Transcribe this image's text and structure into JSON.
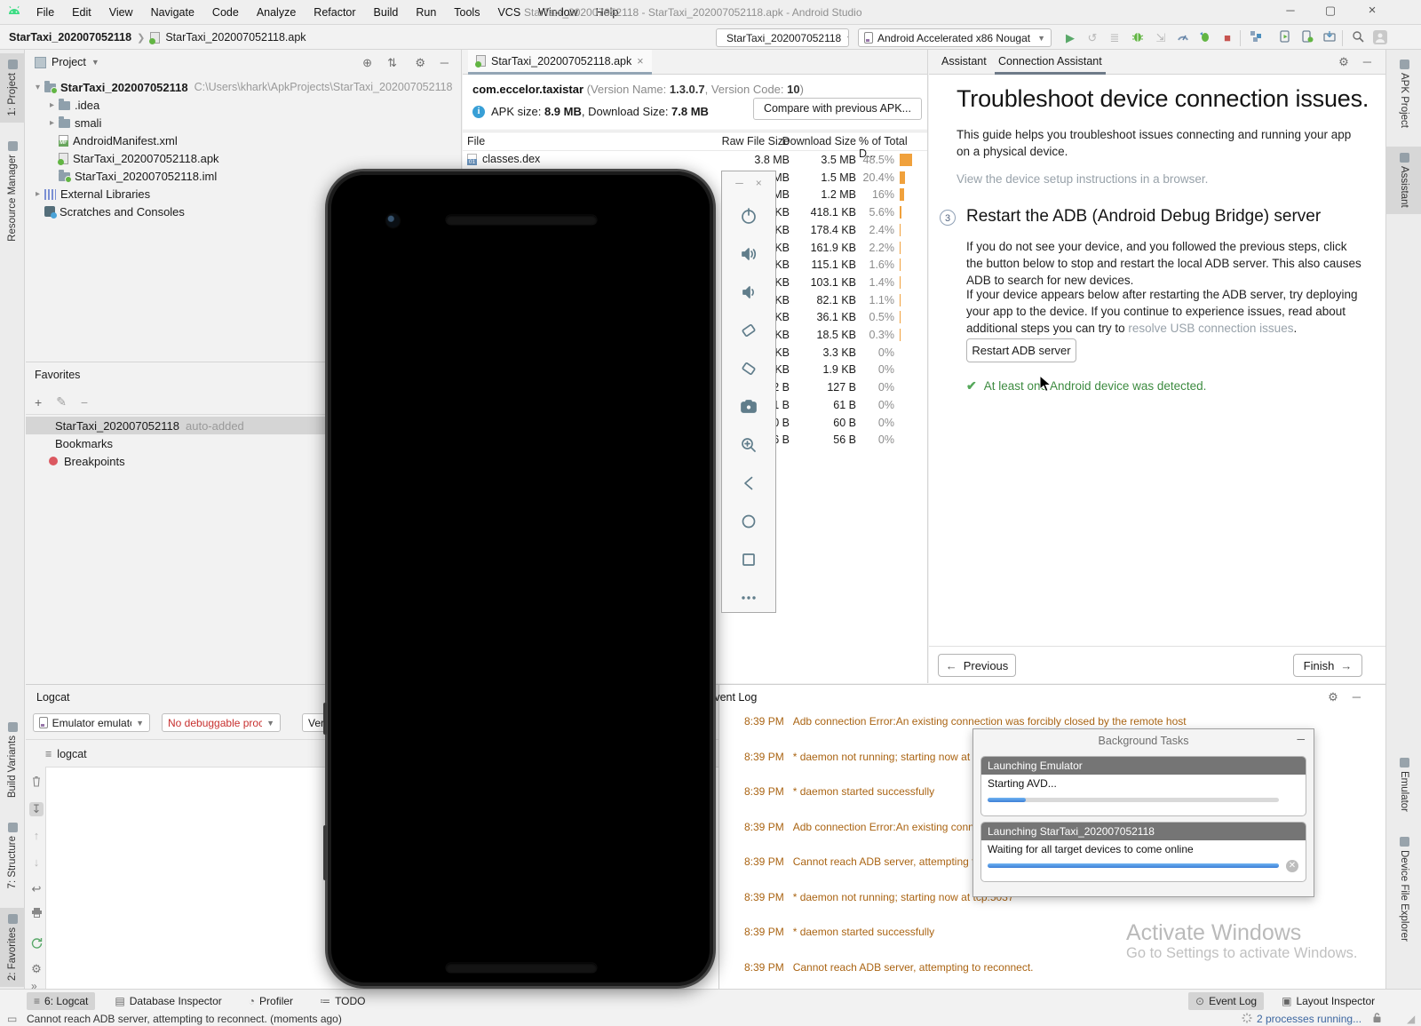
{
  "window": {
    "title": "StarTaxi_202007052118 - StarTaxi_202007052118.apk - Android Studio",
    "controls": {
      "minimize": "─",
      "maximize": "▢",
      "close": "×"
    }
  },
  "menu_items": [
    "File",
    "Edit",
    "View",
    "Navigate",
    "Code",
    "Analyze",
    "Refactor",
    "Build",
    "Run",
    "Tools",
    "VCS",
    "Window",
    "Help"
  ],
  "toolbar": {
    "breadcrumb_project": "StarTaxi_202007052118",
    "breadcrumb_file": "StarTaxi_202007052118.apk",
    "run_config": "StarTaxi_202007052118",
    "device_select": "Android Accelerated x86 Nougat"
  },
  "left_strip_top": [
    {
      "label": "1: Project",
      "sel": true
    },
    {
      "label": "Resource Manager"
    }
  ],
  "left_strip_bottom": [
    {
      "label": "Build Variants"
    },
    {
      "label": "7: Structure"
    },
    {
      "label": "2: Favorites",
      "sel": true
    }
  ],
  "right_strip_top": [
    {
      "label": "APK Project"
    },
    {
      "label": "Assistant",
      "sel": true
    }
  ],
  "right_strip_bottom": [
    {
      "label": "Emulator"
    },
    {
      "label": "Device File Explorer"
    }
  ],
  "project_panel": {
    "title": "Project",
    "tree": [
      {
        "label": "StarTaxi_202007052118",
        "path": "C:\\Users\\khark\\ApkProjects\\StarTaxi_202007052118",
        "level": 0,
        "icon": "folder-root",
        "chevron": "▾",
        "bold": true
      },
      {
        "label": ".idea",
        "level": 1,
        "icon": "folder",
        "chevron": "▸"
      },
      {
        "label": "smali",
        "level": 1,
        "icon": "folder",
        "chevron": "▸"
      },
      {
        "label": "AndroidManifest.xml",
        "level": 1,
        "icon": "manifest",
        "chevron": ""
      },
      {
        "label": "StarTaxi_202007052118.apk",
        "level": 1,
        "icon": "apk",
        "chevron": ""
      },
      {
        "label": "StarTaxi_202007052118.iml",
        "level": 1,
        "icon": "iml",
        "chevron": ""
      },
      {
        "label": "External Libraries",
        "level": 0,
        "icon": "extlib",
        "chevron": "▸"
      },
      {
        "label": "Scratches and Consoles",
        "level": 0,
        "icon": "scratch",
        "chevron": ""
      }
    ]
  },
  "favorites_panel": {
    "title": "Favorites",
    "toolbar": {
      "add": "+",
      "edit": "✎",
      "remove": "−"
    },
    "items": [
      {
        "label": "StarTaxi_202007052118",
        "suffix": "auto-added",
        "icon": "star",
        "sel": true
      },
      {
        "label": "Bookmarks",
        "suffix": "",
        "icon": "check"
      },
      {
        "label": "Breakpoints",
        "suffix": "",
        "icon": "dot"
      }
    ]
  },
  "apk_editor": {
    "tab": "StarTaxi_202007052118.apk",
    "close": "×",
    "package": "com.eccelor.taxistar",
    "v_open": " (Version Name: ",
    "version_name": "1.3.0.7",
    "v_mid": ", Version Code: ",
    "version_code": "10",
    "v_close": ")",
    "s_pre": "APK size: ",
    "apk_size": "8.9 MB",
    "s_mid": ", Download Size: ",
    "download_size": "7.8 MB",
    "compare_button": "Compare with previous APK...",
    "col_file": "File",
    "col_raw": "Raw File Size",
    "col_download": "Download Size",
    "col_pct": "% of Total D...",
    "rows": [
      {
        "file": "classes.dex",
        "raw": "3.8 MB",
        "download": "3.5 MB",
        "pct": "48.5%",
        "pct_val": 48.5
      },
      {
        "file": "",
        "raw": "MB",
        "download": "1.5 MB",
        "pct": "20.4%",
        "pct_val": 20.4
      },
      {
        "file": "",
        "raw": "MB",
        "download": "1.2 MB",
        "pct": "16%",
        "pct_val": 16
      },
      {
        "file": "",
        "raw": "KB",
        "download": "418.1 KB",
        "pct": "5.6%",
        "pct_val": 5.6
      },
      {
        "file": "",
        "raw": "KB",
        "download": "178.4 KB",
        "pct": "2.4%",
        "pct_val": 2.4
      },
      {
        "file": "",
        "raw": "KB",
        "download": "161.9 KB",
        "pct": "2.2%",
        "pct_val": 2.2
      },
      {
        "file": "",
        "raw": "KB",
        "download": "115.1 KB",
        "pct": "1.6%",
        "pct_val": 1.6
      },
      {
        "file": "",
        "raw": "KB",
        "download": "103.1 KB",
        "pct": "1.4%",
        "pct_val": 1.4
      },
      {
        "file": "",
        "raw": "KB",
        "download": "82.1 KB",
        "pct": "1.1%",
        "pct_val": 1.1
      },
      {
        "file": "",
        "raw": "KB",
        "download": "36.1 KB",
        "pct": "0.5%",
        "pct_val": 0.5
      },
      {
        "file": "",
        "raw": "KB",
        "download": "18.5 KB",
        "pct": "0.3%",
        "pct_val": 0.3
      },
      {
        "file": "",
        "raw": "KB",
        "download": "3.3 KB",
        "pct": "0%",
        "pct_val": 0
      },
      {
        "file": "",
        "raw": "KB",
        "download": "1.9 KB",
        "pct": "0%",
        "pct_val": 0
      },
      {
        "file": "",
        "raw": "2 B",
        "download": "127 B",
        "pct": "0%",
        "pct_val": 0
      },
      {
        "file": "",
        "raw": "1 B",
        "download": "61 B",
        "pct": "0%",
        "pct_val": 0
      },
      {
        "file": "",
        "raw": "0 B",
        "download": "60 B",
        "pct": "0%",
        "pct_val": 0
      },
      {
        "file": "",
        "raw": "6 B",
        "download": "56 B",
        "pct": "0%",
        "pct_val": 0
      }
    ]
  },
  "assistant_panel": {
    "tab_assistant": "Assistant",
    "tab_connection": "Connection Assistant",
    "title": "Troubleshoot device connection issues.",
    "intro": "This guide helps you troubleshoot issues connecting and running your app on a physical device.",
    "browser_link": "View the device setup instructions in a browser.",
    "step_number": "3",
    "step_title": "Restart the ADB (Android Debug Bridge) server",
    "para1": "If you do not see your device, and you followed the previous steps, click the button below to stop and restart the local ADB server. This also causes ADB to search for new devices.",
    "para2_pre": "If your device appears below after restarting the ADB server, try deploying your app to the device. If you continue to experience issues, read about additional steps you can try to ",
    "para2_link": "resolve USB connection issues",
    "para2_post": ".",
    "restart_button": "Restart ADB server",
    "success_check": "✔",
    "success_message": "At least one Android device was detected.",
    "previous_button": "Previous",
    "finish_button": "Finish"
  },
  "logcat_panel": {
    "title": "Logcat",
    "device_dropdown": "Emulator emulatc",
    "process_dropdown": "No debuggable proc",
    "level_dropdown": "Verb",
    "tab_label": "logcat",
    "overflow": "»"
  },
  "event_log": {
    "title": "Event Log",
    "entries": [
      {
        "time": "8:39 PM",
        "text": "Adb connection Error:An existing connection was forcibly closed by the remote host"
      },
      {
        "time": "8:39 PM",
        "text": "* daemon not running; starting now at tcp:5037"
      },
      {
        "time": "8:39 PM",
        "text": "* daemon started successfully"
      },
      {
        "time": "8:39 PM",
        "text": "Adb connection Error:An existing connection was forcibly closed by the remote host"
      },
      {
        "time": "8:39 PM",
        "text": "Cannot reach ADB server, attempting to reconnect."
      },
      {
        "time": "8:39 PM",
        "text": "* daemon not running; starting now at tcp:5037"
      },
      {
        "time": "8:39 PM",
        "text": "* daemon started successfully"
      },
      {
        "time": "8:39 PM",
        "text": "Cannot reach ADB server, attempting to reconnect."
      }
    ]
  },
  "background_tasks": {
    "title": "Background Tasks",
    "task1_header": "Launching Emulator",
    "task1_status": "Starting AVD...",
    "task1_progress_pct": 13,
    "task2_header": "Launching StarTaxi_202007052118",
    "task2_status": "Waiting for all target devices to come online",
    "task2_progress_pct": 100
  },
  "bottom_bar": {
    "left": [
      {
        "label": "6: Logcat",
        "icon": "logcat",
        "sel": true
      },
      {
        "label": "Database Inspector",
        "icon": "database"
      },
      {
        "label": "Profiler",
        "icon": "profiler"
      },
      {
        "label": "TODO",
        "icon": "todo"
      }
    ],
    "right": [
      {
        "label": "Event Log",
        "icon": "event-log",
        "sel": true
      },
      {
        "label": "Layout Inspector",
        "icon": "layout-inspector"
      }
    ]
  },
  "status_bar": {
    "message": "Cannot reach ADB server, attempting to reconnect. (moments ago)",
    "processes": "2 processes running..."
  },
  "watermark": {
    "line1": "Activate Windows",
    "line2": "Go to Settings to activate Windows."
  },
  "emulator": {
    "toolbar_icons": [
      "minimize",
      "close",
      "power",
      "volume-up",
      "volume-down",
      "rotate-left",
      "rotate-right",
      "screenshot",
      "zoom",
      "back",
      "home",
      "overview",
      "more"
    ]
  },
  "colors": {
    "pct_bar_orange": "#F0A13C",
    "event_log_text": "#AA6413",
    "success_green": "#3D8B40",
    "progress_blue": "#4A90E2",
    "stop_red": "#C75450",
    "run_green": "#59A869"
  }
}
